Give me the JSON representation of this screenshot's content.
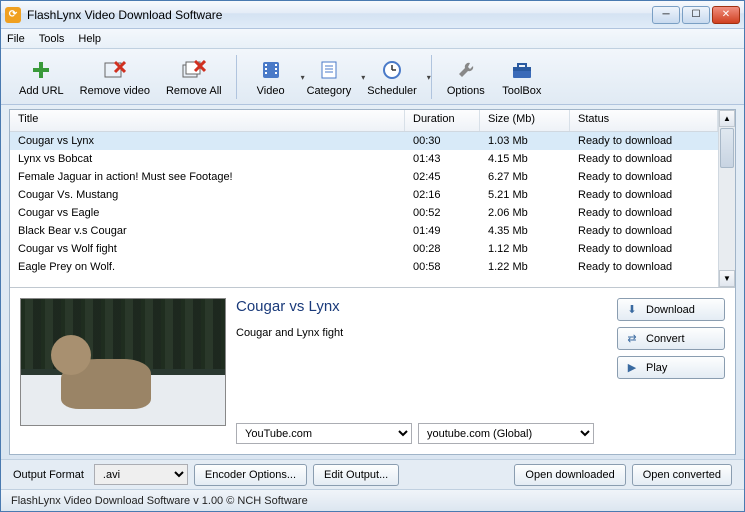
{
  "titlebar": {
    "title": "FlashLynx Video Download Software"
  },
  "menu": {
    "file": "File",
    "tools": "Tools",
    "help": "Help"
  },
  "toolbar": {
    "add": "Add URL",
    "remove": "Remove video",
    "removeall": "Remove All",
    "video": "Video",
    "category": "Category",
    "scheduler": "Scheduler",
    "options": "Options",
    "toolbox": "ToolBox"
  },
  "columns": {
    "title": "Title",
    "duration": "Duration",
    "size": "Size (Mb)",
    "status": "Status"
  },
  "rows": [
    {
      "title": "Cougar vs Lynx",
      "duration": "00:30",
      "size": "1.03 Mb",
      "status": "Ready to download",
      "selected": true
    },
    {
      "title": "Lynx vs Bobcat",
      "duration": "01:43",
      "size": "4.15 Mb",
      "status": "Ready to download"
    },
    {
      "title": "Female Jaguar in action! Must see Footage!",
      "duration": "02:45",
      "size": "6.27 Mb",
      "status": "Ready to download"
    },
    {
      "title": "Cougar Vs. Mustang",
      "duration": "02:16",
      "size": "5.21 Mb",
      "status": "Ready to download"
    },
    {
      "title": "Cougar vs Eagle",
      "duration": "00:52",
      "size": "2.06 Mb",
      "status": "Ready to download"
    },
    {
      "title": "Black Bear v.s Cougar",
      "duration": "01:49",
      "size": "4.35 Mb",
      "status": "Ready to download"
    },
    {
      "title": "Cougar vs Wolf fight",
      "duration": "00:28",
      "size": "1.12 Mb",
      "status": "Ready to download"
    },
    {
      "title": "Eagle Prey on Wolf.",
      "duration": "00:58",
      "size": "1.22 Mb",
      "status": "Ready to download"
    }
  ],
  "detail": {
    "title": "Cougar vs Lynx",
    "desc": "Cougar and Lynx fight",
    "source": "YouTube.com",
    "site": "youtube.com (Global)"
  },
  "actions": {
    "download": "Download",
    "convert": "Convert",
    "play": "Play"
  },
  "bottom": {
    "output_label": "Output Format",
    "format": ".avi",
    "encoder": "Encoder Options...",
    "edit": "Edit Output...",
    "opendl": "Open downloaded",
    "openconv": "Open converted"
  },
  "status": "FlashLynx Video Download Software v 1.00 © NCH Software"
}
